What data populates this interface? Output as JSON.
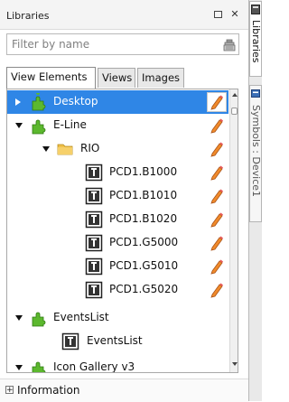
{
  "titlebar": {
    "title": "Libraries"
  },
  "filter": {
    "placeholder": "Filter by name",
    "value": ""
  },
  "tabs": [
    {
      "label": "View Elements",
      "active": true
    },
    {
      "label": "Views",
      "active": false
    },
    {
      "label": "Images",
      "active": false
    }
  ],
  "tree": {
    "items": [
      {
        "label": "Desktop",
        "type": "library",
        "expanded": false,
        "selected": true
      },
      {
        "label": "E-Line",
        "type": "library",
        "expanded": true,
        "selected": false
      },
      {
        "label": "RIO",
        "type": "folder",
        "expanded": true,
        "selected": false
      },
      {
        "label": "PCD1.B1000",
        "type": "element",
        "selected": false
      },
      {
        "label": "PCD1.B1010",
        "type": "element",
        "selected": false
      },
      {
        "label": "PCD1.B1020",
        "type": "element",
        "selected": false
      },
      {
        "label": "PCD1.G5000",
        "type": "element",
        "selected": false
      },
      {
        "label": "PCD1.G5010",
        "type": "element",
        "selected": false
      },
      {
        "label": "PCD1.G5020",
        "type": "element",
        "selected": false
      },
      {
        "label": "EventsList",
        "type": "library",
        "expanded": true,
        "selected": false
      },
      {
        "label": "EventsList",
        "type": "element",
        "selected": false
      },
      {
        "label": "Icon Gallery v3",
        "type": "library",
        "expanded": true,
        "selected": false
      }
    ]
  },
  "info": {
    "label": "Information"
  },
  "dock": {
    "tab1_label": "Libraries",
    "tab2_label": "Symbols : Device1"
  },
  "colors": {
    "selection": "#2f86e6",
    "library_icon": "#5cb82e",
    "folder": "#f0c14a"
  }
}
